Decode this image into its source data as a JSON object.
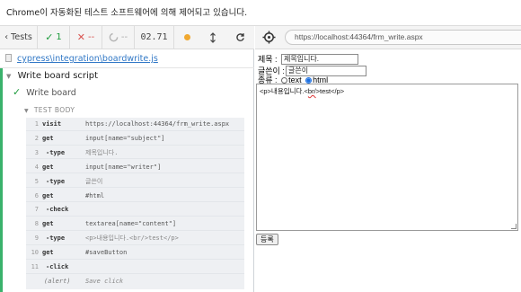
{
  "infobar": {
    "message": "Chrome이 자동화된 테스트 소프트웨어에 의해 제어되고 있습니다."
  },
  "reporter": {
    "tests_label": "Tests",
    "passed": "1",
    "failed": "--",
    "duration": "02.71",
    "status_color": "#f0a830"
  },
  "spec": {
    "path": "cypress\\integration\\boardwrite.js"
  },
  "suite": {
    "title": "Write board script"
  },
  "test": {
    "title": "Write board",
    "status": "passed"
  },
  "test_body_label": "TEST BODY",
  "commands": [
    {
      "num": "1",
      "name": "visit",
      "message": "https://localhost:44364/frm_write.aspx"
    },
    {
      "num": "2",
      "name": "get",
      "message": "input[name=\"subject\"]"
    },
    {
      "num": "3",
      "name": "-type",
      "message": "제목입니다."
    },
    {
      "num": "4",
      "name": "get",
      "message": "input[name=\"writer\"]"
    },
    {
      "num": "5",
      "name": "-type",
      "message": "글쓴이"
    },
    {
      "num": "6",
      "name": "get",
      "message": "#html"
    },
    {
      "num": "7",
      "name": "-check",
      "message": ""
    },
    {
      "num": "8",
      "name": "get",
      "message": "textarea[name=\"content\"]"
    },
    {
      "num": "9",
      "name": "-type",
      "message": "<p>내용입니다.<br/>test</p>"
    },
    {
      "num": "10",
      "name": "get",
      "message": "#saveButton"
    },
    {
      "num": "11",
      "name": "-click",
      "message": ""
    },
    {
      "num": "",
      "name": "(alert)",
      "message": "Save click"
    }
  ],
  "browser": {
    "url": "https://localhost:44364/frm_write.aspx"
  },
  "form": {
    "subject_label": "제목 :",
    "subject_value": "제목입니다.",
    "writer_label": "글쓴이 :",
    "writer_value": "글쓴이",
    "type_label": "종류 :",
    "radio_text": "text",
    "radio_html": "html",
    "content_pre": "<p>내용입니다.<",
    "content_hl": "br/",
    "content_post": ">test</p>",
    "submit_label": "등록"
  }
}
